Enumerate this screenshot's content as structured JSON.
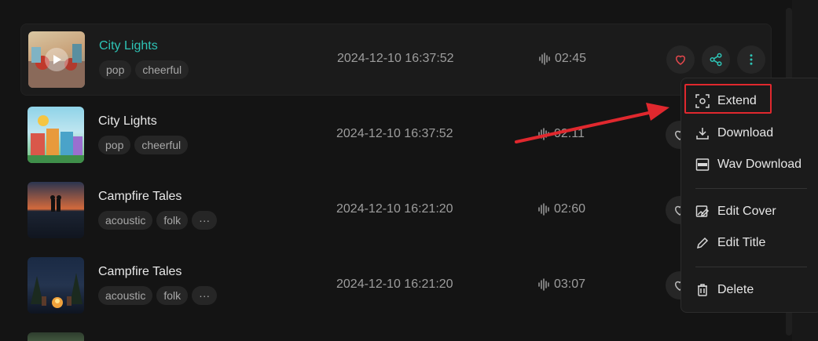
{
  "songs": [
    {
      "title": "City Lights",
      "tags": [
        "pop",
        "cheerful"
      ],
      "date": "2024-12-10 16:37:52",
      "duration": "02:45",
      "active": true
    },
    {
      "title": "City Lights",
      "tags": [
        "pop",
        "cheerful"
      ],
      "date": "2024-12-10 16:37:52",
      "duration": "02:11"
    },
    {
      "title": "Campfire Tales",
      "tags": [
        "acoustic",
        "folk"
      ],
      "more": "···",
      "date": "2024-12-10 16:21:20",
      "duration": "02:60"
    },
    {
      "title": "Campfire Tales",
      "tags": [
        "acoustic",
        "folk"
      ],
      "more": "···",
      "date": "2024-12-10 16:21:20",
      "duration": "03:07"
    }
  ],
  "menu": {
    "extend": "Extend",
    "download": "Download",
    "wav_download": "Wav Download",
    "edit_cover": "Edit Cover",
    "edit_title": "Edit Title",
    "delete": "Delete"
  },
  "icons": {
    "favorite": "heart-icon",
    "share": "share-icon",
    "more": "more-vertical-icon",
    "waveform": "waveform-icon"
  },
  "colors": {
    "accent": "#2ec4b6",
    "heart": "#e5484d",
    "highlight": "#e0282e",
    "arrow": "#e0282e"
  }
}
